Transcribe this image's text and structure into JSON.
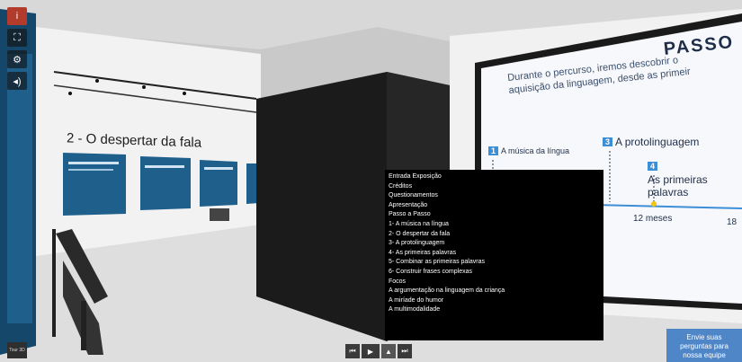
{
  "colors": {
    "panel": "#1f5f8c",
    "screen": "#f7f8fb",
    "accent": "#3c8fd6",
    "menu_bg": "#000000",
    "feedback": "#4f86c8",
    "wall_dark": "#1d1d1d"
  },
  "toolbar": {
    "icons": [
      "info-icon",
      "fullscreen-icon",
      "gear-icon",
      "volume-icon"
    ],
    "labels": [
      "i",
      "⛶",
      "⚙",
      "◂)"
    ]
  },
  "wall": {
    "title": "2 - O despertar da fala"
  },
  "screen": {
    "title": "PASSO",
    "subtitle_line1": "Durante o percurso, iremos descobrir o",
    "subtitle_line2": "aquisição da linguagem, desde as primeir",
    "steps": [
      {
        "num": "1",
        "label": "A música da língua"
      },
      {
        "num": "3",
        "label": "A protolinguagem"
      },
      {
        "num": "4",
        "label": "As primeiras palavras"
      }
    ],
    "months": [
      "12 meses",
      "18"
    ]
  },
  "menu": {
    "items": [
      "Entrada Exposição",
      "Créditos",
      "Questionamentos",
      "Apresentação",
      "Passo a Passo",
      "1- A música na língua",
      "2- O despertar da fala",
      "3- A protolinguagem",
      "4- As primeiras palavras",
      "5- Combinar as primeiras palavras",
      "6- Construir frases complexas",
      "Focos",
      "A argumentação na linguagem da criança",
      "A miríade do humor",
      "A multimodalidade"
    ]
  },
  "controls": {
    "labels": [
      "⏮",
      "▶",
      "▲",
      "⏭"
    ]
  },
  "feedback": {
    "line1": "Envie suas",
    "line2": "perguntas para",
    "line3": "nossa equipe"
  },
  "corner": {
    "text": "Tour 3D"
  }
}
